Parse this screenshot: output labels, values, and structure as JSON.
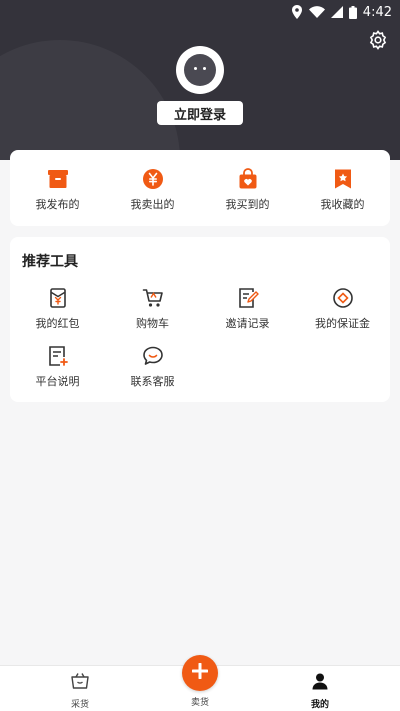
{
  "status_bar": {
    "time": "4:42"
  },
  "profile": {
    "login_label": "立即登录"
  },
  "orders": [
    {
      "label": "我发布的",
      "icon": "box-icon"
    },
    {
      "label": "我卖出的",
      "icon": "yen-coin-icon"
    },
    {
      "label": "我买到的",
      "icon": "shopping-bag-icon"
    },
    {
      "label": "我收藏的",
      "icon": "bookmark-star-icon"
    }
  ],
  "tools": {
    "title": "推荐工具",
    "items": [
      {
        "label": "我的红包",
        "icon": "red-envelope-icon"
      },
      {
        "label": "购物车",
        "icon": "shopping-cart-icon"
      },
      {
        "label": "邀请记录",
        "icon": "invite-record-icon"
      },
      {
        "label": "我的保证金",
        "icon": "deposit-icon"
      },
      {
        "label": "平台说明",
        "icon": "platform-doc-icon"
      },
      {
        "label": "联系客服",
        "icon": "chat-bubble-icon"
      }
    ]
  },
  "bottom_nav": {
    "purchase": "采货",
    "sell": "卖货",
    "mine": "我的"
  },
  "colors": {
    "accent": "#f05a14",
    "header_bg": "#34333b",
    "page_bg": "#f6f6f7"
  }
}
